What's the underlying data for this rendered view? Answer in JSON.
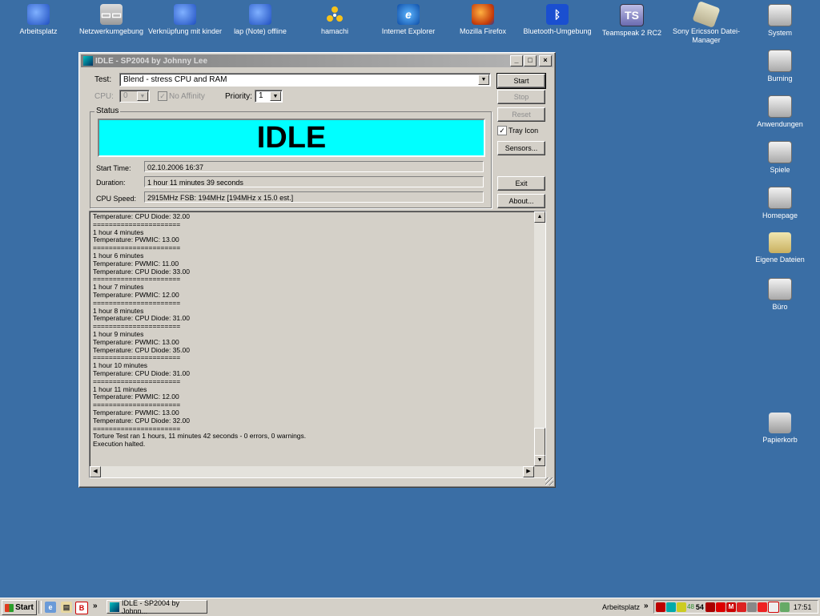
{
  "desktop": {
    "top_icons": [
      {
        "label": "Arbeitsplatz",
        "icon": "network-computer-icon"
      },
      {
        "label": "Netzwerkumgebung",
        "icon": "network-places-icon"
      },
      {
        "label": "Verknüpfung mit kinder",
        "icon": "network-shortcut-icon"
      },
      {
        "label": "lap (Note) offline",
        "icon": "network-offline-icon"
      },
      {
        "label": "hamachi",
        "icon": "hamachi-icon"
      },
      {
        "label": "Internet Explorer",
        "icon": "internet-explorer-icon"
      },
      {
        "label": "Mozilla Firefox",
        "icon": "firefox-icon"
      },
      {
        "label": "Bluetooth-Umgebung",
        "icon": "bluetooth-icon"
      },
      {
        "label": "Teamspeak 2 RC2",
        "icon": "teamspeak-icon"
      },
      {
        "label": "Sony Ericsson Datei-Manager",
        "icon": "phone-icon"
      }
    ],
    "right_icons": [
      {
        "label": "System",
        "icon": "drive-icon"
      },
      {
        "label": "Burning",
        "icon": "drive-icon"
      },
      {
        "label": "Anwendungen",
        "icon": "drive-icon"
      },
      {
        "label": "Spiele",
        "icon": "drive-icon"
      },
      {
        "label": "Homepage",
        "icon": "drive-icon"
      },
      {
        "label": "Eigene Dateien",
        "icon": "my-documents-icon"
      },
      {
        "label": "Büro",
        "icon": "drive-icon"
      },
      {
        "label": "Papierkorb",
        "icon": "recycle-bin-icon"
      }
    ]
  },
  "window": {
    "title": "IDLE - SP2004 by Johnny Lee",
    "test_label": "Test:",
    "test_value": "Blend - stress CPU and RAM",
    "cpu_label": "CPU:",
    "cpu_value": "0",
    "no_affinity_label": "No Affinity",
    "priority_label": "Priority:",
    "priority_value": "1",
    "status_label": "Status",
    "status_text": "IDLE",
    "start_time_label": "Start Time:",
    "start_time_value": "02.10.2006 16:37",
    "duration_label": "Duration:",
    "duration_value": "1 hour 11 minutes 39 seconds",
    "cpu_speed_label": "CPU Speed:",
    "cpu_speed_value": "2915MHz FSB: 194MHz [194MHz x 15.0 est.]",
    "buttons": {
      "start": "Start",
      "stop": "Stop",
      "reset": "Reset",
      "tray_icon": "Tray Icon",
      "sensors": "Sensors...",
      "exit": "Exit",
      "about": "About..."
    },
    "status_color": "#00ffff",
    "log_lines": [
      "Temperature: CPU Diode: 32.00",
      "======================",
      "1 hour 4 minutes",
      "Temperature: PWMIC: 13.00",
      "======================",
      "1 hour 6 minutes",
      "Temperature: PWMIC: 11.00",
      "Temperature: CPU Diode: 33.00",
      "======================",
      "1 hour 7 minutes",
      "Temperature: PWMIC: 12.00",
      "======================",
      "1 hour 8 minutes",
      "Temperature: CPU Diode: 31.00",
      "======================",
      "1 hour 9 minutes",
      "Temperature: PWMIC: 13.00",
      "Temperature: CPU Diode: 35.00",
      "======================",
      "1 hour 10 minutes",
      "Temperature: CPU Diode: 31.00",
      "======================",
      "1 hour 11 minutes",
      "Temperature: PWMIC: 12.00",
      "======================",
      "Temperature: PWMIC: 13.00",
      "Temperature: CPU Diode: 32.00",
      "======================",
      "Torture Test ran 1 hours, 11 minutes 42 seconds - 0 errors, 0 warnings.",
      "Execution halted."
    ]
  },
  "taskbar": {
    "start_label": "Start",
    "overflow": "»",
    "task_label": "IDLE - SP2004 by Johnn...",
    "tray_label": "Arbeitsplatz",
    "tray_overflow": "»",
    "tray_num1": "48",
    "tray_num2": "54",
    "clock": "17:51"
  }
}
